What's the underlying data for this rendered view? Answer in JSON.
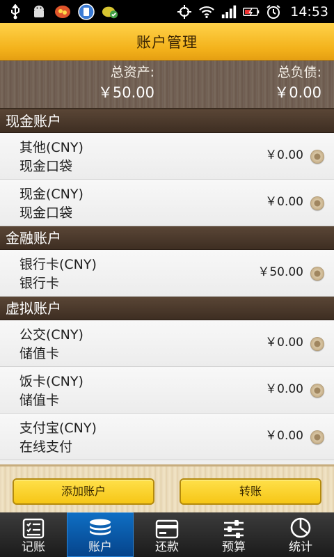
{
  "status_bar": {
    "time": "14:53",
    "icons": [
      "usb-icon",
      "android-icon",
      "app-icon",
      "sim-icon",
      "app2-icon",
      "gps-icon",
      "wifi-icon",
      "signal-icon",
      "battery-icon",
      "alarm-icon"
    ]
  },
  "header": {
    "title": "账户管理"
  },
  "summary": {
    "assets_label": "总资产:",
    "assets_value": "￥50.00",
    "debts_label": "总负债:",
    "debts_value": "￥0.00"
  },
  "groups": [
    {
      "title": "现金账户",
      "accounts": [
        {
          "name": "其他(CNY)",
          "type": "现金口袋",
          "amount": "￥0.00"
        },
        {
          "name": "现金(CNY)",
          "type": "现金口袋",
          "amount": "￥0.00"
        }
      ]
    },
    {
      "title": "金融账户",
      "accounts": [
        {
          "name": "银行卡(CNY)",
          "type": "银行卡",
          "amount": "￥50.00"
        }
      ]
    },
    {
      "title": "虚拟账户",
      "accounts": [
        {
          "name": "公交(CNY)",
          "type": "储值卡",
          "amount": "￥0.00"
        },
        {
          "name": "饭卡(CNY)",
          "type": "储值卡",
          "amount": "￥0.00"
        },
        {
          "name": "支付宝(CNY)",
          "type": "在线支付",
          "amount": "￥0.00"
        }
      ]
    }
  ],
  "actions": {
    "add_account": "添加账户",
    "transfer": "转账"
  },
  "tabs": [
    {
      "label": "记账",
      "icon": "checklist-icon",
      "active": false
    },
    {
      "label": "账户",
      "icon": "coins-icon",
      "active": true
    },
    {
      "label": "还款",
      "icon": "card-icon",
      "active": false
    },
    {
      "label": "预算",
      "icon": "sliders-icon",
      "active": false
    },
    {
      "label": "统计",
      "icon": "pie-chart-icon",
      "active": false
    }
  ],
  "colors": {
    "accent": "#f3b21b",
    "active_tab": "#0f6fc4",
    "group_header": "#4a392c"
  }
}
